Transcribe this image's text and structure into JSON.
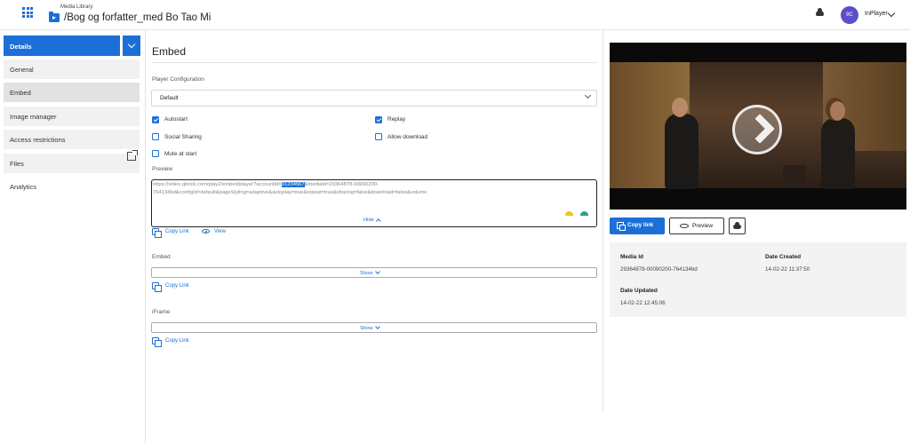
{
  "header": {
    "app_label": "Media Library",
    "title": "/Bog og forfatter_med Bo Tao Mi",
    "avatar_initials": "9C",
    "account_name": "InPlayer"
  },
  "sidebar": {
    "details_label": "Details",
    "items": [
      {
        "label": "General"
      },
      {
        "label": "Embed"
      },
      {
        "label": "Image manager"
      },
      {
        "label": "Access restrictions"
      },
      {
        "label": "Files"
      },
      {
        "label": "Analytics"
      }
    ]
  },
  "main": {
    "title": "Embed",
    "player_config_label": "Player Configuration",
    "player_config_value": "Default",
    "options": {
      "autostart": {
        "label": "Autostart",
        "checked": true
      },
      "replay": {
        "label": "Replay",
        "checked": true
      },
      "social_sharing": {
        "label": "Social Sharing",
        "checked": false
      },
      "allow_download": {
        "label": "Allow download",
        "checked": false
      },
      "mute_at_start": {
        "label": "Mute at start",
        "checked": false
      }
    },
    "preview_label": "Preview",
    "preview_url_before": "https://video.qbrick.com/play2/embed/player?accountId=",
    "preview_url_highlight": "01234567",
    "preview_url_after": "&mediaId=29364878-00090200-764134bd&configId=default&pageStyling=adaptive&autoplay=true&repeat=true&sharing=false&download=false&volume",
    "hide_label": "Hide",
    "copy_link_label": "Copy Link",
    "view_label": "View",
    "embed_label": "Embed",
    "iframe_label": "iFrame",
    "show_label": "Show"
  },
  "right": {
    "copy_link_button": "Copy link",
    "preview_button": "Preview",
    "media_id_label": "Media Id",
    "media_id_value": "29364878-00090200-764134bd",
    "date_created_label": "Date Created",
    "date_created_value": "14-02-22 11:37:50",
    "date_updated_label": "Date Updated",
    "date_updated_value": "14-02-22 12:45:06"
  },
  "colors": {
    "accent": "#1c6fd6",
    "avatar": "#5b4fc9"
  }
}
